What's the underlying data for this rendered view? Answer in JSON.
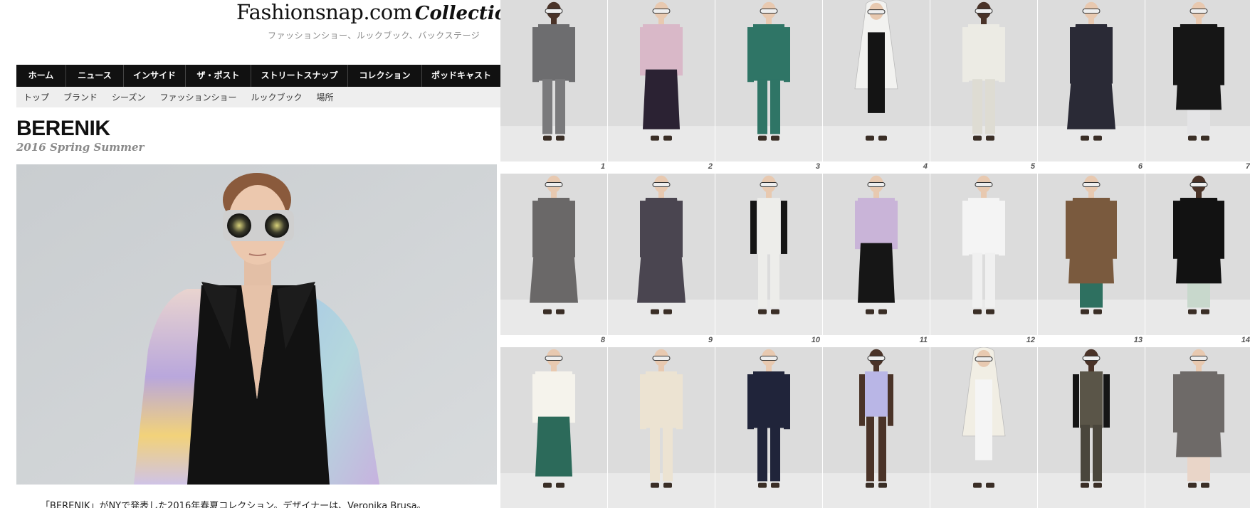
{
  "header": {
    "site_name": "Fashionsnap.com",
    "section_name": "Collection",
    "tagline": "ファッションショー、ルックブック、バックステージ"
  },
  "main_nav": [
    {
      "label": "ホーム"
    },
    {
      "label": "ニュース"
    },
    {
      "label": "インサイド"
    },
    {
      "label": "ザ・ポスト"
    },
    {
      "label": "ストリートスナップ"
    },
    {
      "label": "コレクション"
    },
    {
      "label": "ポッドキャスト"
    }
  ],
  "sub_nav": [
    {
      "label": "トップ"
    },
    {
      "label": "ブランド"
    },
    {
      "label": "シーズン"
    },
    {
      "label": "ファッションショー"
    },
    {
      "label": "ルックブック"
    },
    {
      "label": "場所"
    }
  ],
  "collection": {
    "brand": "BERENIK",
    "season": "2016 Spring Summer",
    "description": "「BERENIK」がNYで発表した2016年春夏コレクション。デザイナーは、Veronika Brusa。"
  },
  "looks": [
    {
      "number": "1",
      "top": "#6d6d6f",
      "bottom": "#7a7a7c",
      "style": "suit",
      "skin": "#4a3328"
    },
    {
      "number": "2",
      "top": "#d9b8c8",
      "bottom": "#2b2233",
      "style": "sweater",
      "skin": "#e8c9b0"
    },
    {
      "number": "3",
      "top": "#2f7566",
      "bottom": "#2f7566",
      "style": "suit",
      "skin": "#e8c9b0"
    },
    {
      "number": "4",
      "top": "#f2f2f0",
      "bottom": "#141414",
      "style": "hood",
      "skin": "#e8c9b0"
    },
    {
      "number": "5",
      "top": "#ecebe4",
      "bottom": "#dedcd3",
      "style": "suit",
      "skin": "#4a3328"
    },
    {
      "number": "6",
      "top": "#2a2a36",
      "bottom": "#cfd3dc",
      "style": "dress",
      "skin": "#e8c9b0"
    },
    {
      "number": "7",
      "top": "#161616",
      "bottom": "#e4e4e6",
      "style": "coat",
      "skin": "#e8c9b0"
    },
    {
      "number": "8",
      "top": "#6a6868",
      "bottom": "#6a6868",
      "style": "dress",
      "skin": "#e8c9b0"
    },
    {
      "number": "9",
      "top": "#4a4550",
      "bottom": "#4a4550",
      "style": "dress",
      "skin": "#e8c9b0"
    },
    {
      "number": "10",
      "top": "#ededea",
      "bottom": "#ededea",
      "style": "vest",
      "skin": "#e8c9b0"
    },
    {
      "number": "11",
      "top": "#c9b4d8",
      "bottom": "#161616",
      "style": "sweater",
      "skin": "#e8c9b0"
    },
    {
      "number": "12",
      "top": "#f4f4f4",
      "bottom": "#f0f0f0",
      "style": "suit",
      "skin": "#e8c9b0"
    },
    {
      "number": "13",
      "top": "#7a5a3e",
      "bottom": "#2e7060",
      "style": "coat",
      "skin": "#e8c9b0"
    },
    {
      "number": "14",
      "top": "#121212",
      "bottom": "#c8d8cc",
      "style": "coat",
      "skin": "#4a3328"
    },
    {
      "number": "",
      "top": "#f5f3ec",
      "bottom": "#2c6a5a",
      "style": "sweater",
      "skin": "#e8c9b0"
    },
    {
      "number": "",
      "top": "#ece3d2",
      "bottom": "#ece3d2",
      "style": "suit",
      "skin": "#e8c9b0"
    },
    {
      "number": "",
      "top": "#20243a",
      "bottom": "#20243a",
      "style": "suit",
      "skin": "#e8c9b0"
    },
    {
      "number": "",
      "top": "#b9b6e6",
      "bottom": "#4a3328",
      "style": "swim",
      "skin": "#4a3328"
    },
    {
      "number": "",
      "top": "#f1eee4",
      "bottom": "#f5f5f5",
      "style": "hood",
      "skin": "#e8c9b0"
    },
    {
      "number": "",
      "top": "#5a5548",
      "bottom": "#4a463c",
      "style": "vest",
      "skin": "#4a3328"
    },
    {
      "number": "",
      "top": "#6e6a68",
      "bottom": "#e9d5c8",
      "style": "coat",
      "skin": "#e8c9b0"
    }
  ],
  "colors": {
    "nav_background": "#111111",
    "subnav_background": "#eeeeee",
    "season_text": "#8a8a8a",
    "page_background": "#ffffff"
  }
}
